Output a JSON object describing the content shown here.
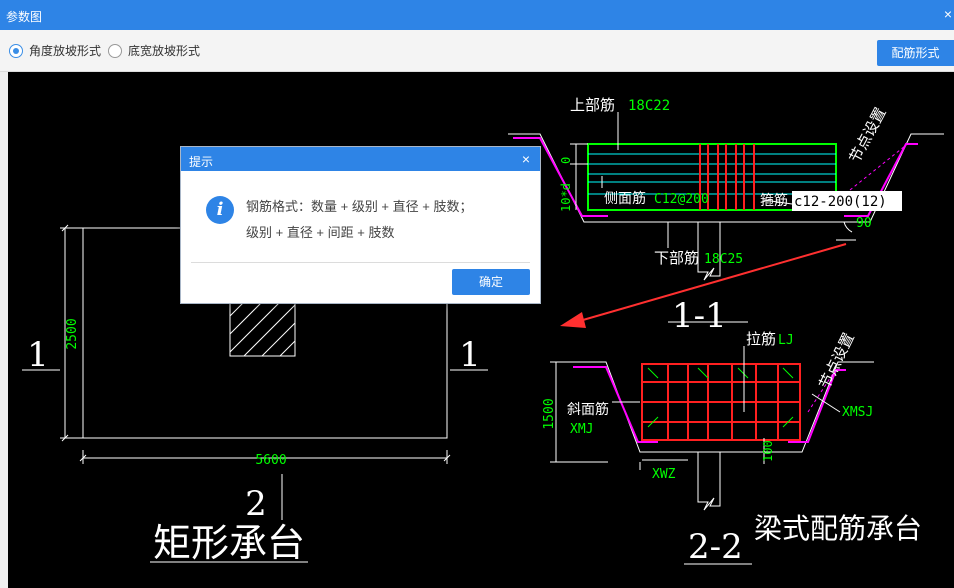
{
  "window": {
    "title": "参数图",
    "close_symbol": "×"
  },
  "toolbar": {
    "radio_options": [
      {
        "label": "角度放坡形式",
        "checked": true
      },
      {
        "label": "底宽放坡形式",
        "checked": false
      }
    ],
    "rebar_form_button": "配筋形式"
  },
  "drawing": {
    "left": {
      "dim_height": "2500",
      "dim_width": "5600",
      "section_mark_left": "1",
      "section_mark_right": "1",
      "section_mark_bottom": "2",
      "caption": "矩形承台"
    },
    "section_1_1": {
      "top_bar_label": "上部筋",
      "top_bar_value": "18C22",
      "dim_zero": "0",
      "dim_side": "10*d",
      "side_bar_label": "侧面筋",
      "side_bar_value": "C12@200",
      "stirrup_label": "箍筋",
      "stirrup_value": "c12-200(12)",
      "node_setting": "节点设置",
      "angle": "90",
      "bottom_bar_label": "下部筋",
      "bottom_bar_value": "18C25",
      "caption": "1-1"
    },
    "section_2_2": {
      "tie_label": "拉筋",
      "tie_value": "LJ",
      "node_setting": "节点设置",
      "dim_height": "1500",
      "slope_label": "斜面筋",
      "slope_value": "XMJ",
      "xmsj": "XMSJ",
      "xwz": "XWZ",
      "dim_bottom": "100",
      "caption": "2-2",
      "title": "梁式配筋承台"
    }
  },
  "dialog": {
    "title": "提示",
    "close_symbol": "×",
    "icon": "info-icon",
    "message_line1": "钢筋格式：数量 + 级别 + 直径 + 肢数；",
    "message_line2": "级别 + 直径 + 间距 + 肢数",
    "ok_label": "确定"
  },
  "colors": {
    "accent": "#2e84e6",
    "canvas": "#000000",
    "cad_green": "#00ff00",
    "cad_red": "#ff2020",
    "cad_cyan": "#00ffff",
    "cad_magenta": "#ff00ff"
  }
}
